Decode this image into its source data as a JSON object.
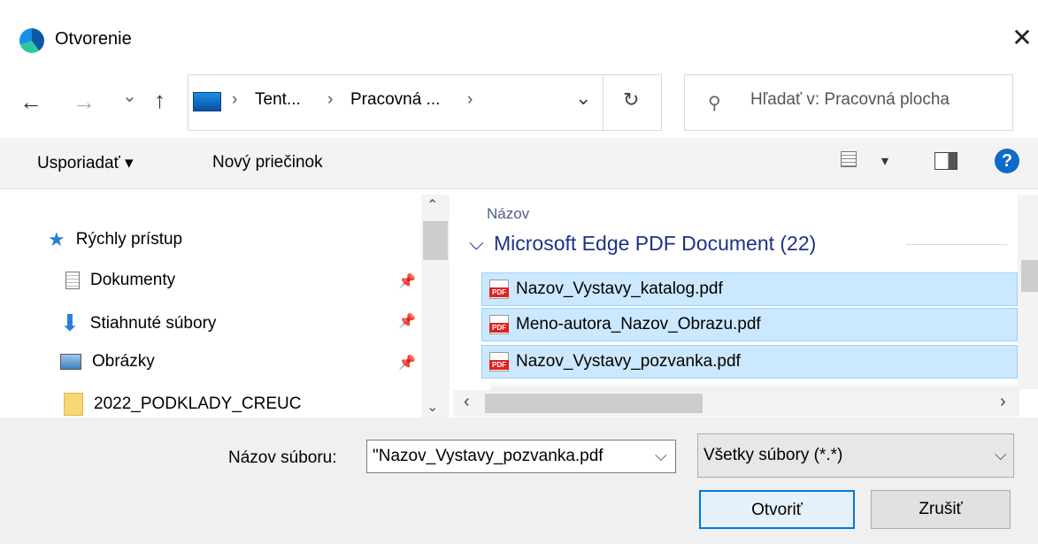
{
  "window": {
    "title": "Otvorenie"
  },
  "nav": {
    "back": "←",
    "forward": "→",
    "recent": "⌄",
    "up": "↑",
    "breadcrumb": [
      "Tent...",
      "Pracovná ..."
    ],
    "sep": "›",
    "dropdown": "⌄",
    "refresh": "↻",
    "search_placeholder": "Hľadať v: Pracovná plocha"
  },
  "toolbar": {
    "organize": "Usporiadať ▾",
    "new_folder": "Nový priečinok",
    "view_arrow": "▾",
    "help": "?"
  },
  "tree": {
    "quick_access": "Rýchly prístup",
    "items": [
      "Dokumenty",
      "Stiahnuté súbory",
      "Obrázky",
      "2022_PODKLADY_CREUC"
    ]
  },
  "files": {
    "column_name": "Názov",
    "group_title": "Microsoft Edge PDF Document (22)",
    "rows": [
      "Nazov_Vystavy_katalog.pdf",
      "Meno-autora_Nazov_Obrazu.pdf",
      "Nazov_Vystavy_pozvanka.pdf"
    ]
  },
  "footer": {
    "filename_label": "Názov súboru:",
    "filename_value": "\"Nazov_Vystavy_pozvanka.pdf",
    "filetype": "Všetky súbory (*.*)",
    "open": "Otvoriť",
    "cancel": "Zrušiť"
  },
  "colors": {
    "accent": "#0078d7",
    "selection": "#cce8ff",
    "group_header": "#1e3287"
  }
}
